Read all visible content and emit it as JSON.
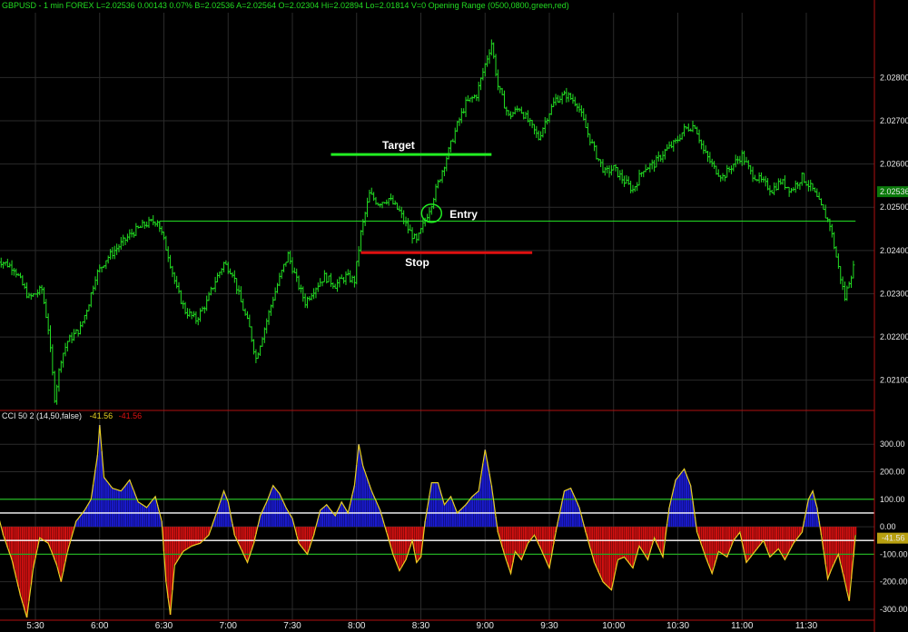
{
  "header": {
    "price_line": "GBPUSD - 1 min  FOREX  L=2.02536  0.00143   0.07%    B=2.02536   A=2.02564   O=2.02304   Hi=2.02894   Lo=2.01814   V=0   Opening Range (0500,0800,green,red)"
  },
  "indicator_header": {
    "name": "CCI 50 2 (14,50,false)",
    "value1": "-41.56",
    "value2": "-41.56"
  },
  "colors": {
    "background": "#000000",
    "bars": "#22dd22",
    "grid": "#2a2a2a",
    "panel_border": "#b01010",
    "target": "#22ee22",
    "stop": "#e01010",
    "cci_line": "#e8d020",
    "cci_positive": "#1a1ad0",
    "cci_negative": "#d01010",
    "level_green": "#22aa22",
    "level_white": "#ffffff"
  },
  "chart_data": [
    {
      "type": "ohlc",
      "instrument": "GBPUSD",
      "interval": "1 min",
      "x_ticks": [
        "5:30",
        "6:00",
        "6:30",
        "7:00",
        "7:30",
        "8:00",
        "8:30",
        "9:00",
        "9:30",
        "10:00",
        "10:30",
        "11:00",
        "11:30"
      ],
      "y_ticks": [
        "2.02800",
        "2.02700",
        "2.02600",
        "2.02500",
        "2.02400",
        "2.02300",
        "2.02200",
        "2.02100"
      ],
      "y_range": [
        2.0203,
        2.0295
      ],
      "last_price_label": "2.02536",
      "last_price": 2.02536,
      "high": 2.02894,
      "low": 2.01814,
      "path": [
        [
          "5:12",
          2.0238
        ],
        [
          "5:20",
          2.0236
        ],
        [
          "5:27",
          2.0229
        ],
        [
          "5:33",
          2.0231
        ],
        [
          "5:36",
          2.0222
        ],
        [
          "5:39",
          2.0206
        ],
        [
          "5:42",
          2.0215
        ],
        [
          "5:45",
          2.0219
        ],
        [
          "5:51",
          2.0222
        ],
        [
          "5:55",
          2.0228
        ],
        [
          "5:58",
          2.0234
        ],
        [
          "6:03",
          2.0238
        ],
        [
          "6:09",
          2.0241
        ],
        [
          "6:15",
          2.0244
        ],
        [
          "6:21",
          2.0246
        ],
        [
          "6:27",
          2.0247
        ],
        [
          "6:32",
          2.0239
        ],
        [
          "6:36",
          2.0231
        ],
        [
          "6:40",
          2.0226
        ],
        [
          "6:45",
          2.0224
        ],
        [
          "6:50",
          2.0228
        ],
        [
          "6:54",
          2.0233
        ],
        [
          "6:58",
          2.0237
        ],
        [
          "7:02",
          2.0235
        ],
        [
          "7:06",
          2.0228
        ],
        [
          "7:10",
          2.0222
        ],
        [
          "7:13",
          2.0215
        ],
        [
          "7:17",
          2.0222
        ],
        [
          "7:21",
          2.0229
        ],
        [
          "7:25",
          2.0235
        ],
        [
          "7:28",
          2.0239
        ],
        [
          "7:32",
          2.0233
        ],
        [
          "7:36",
          2.0228
        ],
        [
          "7:40",
          2.0231
        ],
        [
          "7:45",
          2.0234
        ],
        [
          "7:50",
          2.0232
        ],
        [
          "7:55",
          2.0234
        ],
        [
          "7:59",
          2.0233
        ],
        [
          "8:02",
          2.0244
        ],
        [
          "8:06",
          2.0253
        ],
        [
          "8:10",
          2.0251
        ],
        [
          "8:15",
          2.0252
        ],
        [
          "8:20",
          2.0249
        ],
        [
          "8:24",
          2.0245
        ],
        [
          "8:28",
          2.0242
        ],
        [
          "8:32",
          2.0247
        ],
        [
          "8:35",
          2.0251
        ],
        [
          "8:39",
          2.0257
        ],
        [
          "8:43",
          2.0263
        ],
        [
          "8:47",
          2.0269
        ],
        [
          "8:51",
          2.0274
        ],
        [
          "8:56",
          2.0276
        ],
        [
          "9:00",
          2.0283
        ],
        [
          "9:03",
          2.0288
        ],
        [
          "9:06",
          2.0278
        ],
        [
          "9:11",
          2.0271
        ],
        [
          "9:16",
          2.0273
        ],
        [
          "9:20",
          2.027
        ],
        [
          "9:25",
          2.0266
        ],
        [
          "9:29",
          2.0271
        ],
        [
          "9:33",
          2.0275
        ],
        [
          "9:38",
          2.0276
        ],
        [
          "9:43",
          2.0274
        ],
        [
          "9:48",
          2.0267
        ],
        [
          "9:52",
          2.0262
        ],
        [
          "9:56",
          2.0258
        ],
        [
          "10:00",
          2.0259
        ],
        [
          "10:05",
          2.0256
        ],
        [
          "10:09",
          2.0254
        ],
        [
          "10:14",
          2.0259
        ],
        [
          "10:19",
          2.026
        ],
        [
          "10:24",
          2.0263
        ],
        [
          "10:29",
          2.0265
        ],
        [
          "10:33",
          2.0268
        ],
        [
          "10:38",
          2.0269
        ],
        [
          "10:42",
          2.0263
        ],
        [
          "10:47",
          2.0259
        ],
        [
          "10:51",
          2.0257
        ],
        [
          "10:56",
          2.026
        ],
        [
          "11:00",
          2.0262
        ],
        [
          "11:04",
          2.0258
        ],
        [
          "11:09",
          2.0256
        ],
        [
          "11:14",
          2.0254
        ],
        [
          "11:18",
          2.0256
        ],
        [
          "11:23",
          2.0254
        ],
        [
          "11:28",
          2.0257
        ],
        [
          "11:33",
          2.0254
        ],
        [
          "11:37",
          2.025
        ],
        [
          "11:41",
          2.0246
        ],
        [
          "11:45",
          2.0236
        ],
        [
          "11:48",
          2.0229
        ],
        [
          "11:50",
          2.0233
        ],
        [
          "11:52",
          2.0236
        ]
      ],
      "opening_range_line": {
        "price": 2.02468,
        "from": "6:28",
        "to": "11:53"
      },
      "annotations": [
        {
          "label": "Target",
          "price": 2.02622,
          "from": "7:48",
          "to": "9:03"
        },
        {
          "label": "Stop",
          "price": 2.02395,
          "from": "8:02",
          "to": "9:22"
        },
        {
          "label": "Entry",
          "price": 2.02486,
          "time": "8:35"
        }
      ]
    },
    {
      "type": "area",
      "name": "CCI 50 2 (14,50,false)",
      "y_ticks": [
        "300.00",
        "200.00",
        "100.00",
        "0.00",
        "-100.00",
        "-200.00",
        "-300.00"
      ],
      "y_range": [
        -340,
        390
      ],
      "levels": [
        100,
        50,
        -50,
        -100
      ],
      "last_value_label": "-41.56",
      "last_value": -41.56,
      "path": [
        [
          "5:12",
          60
        ],
        [
          "5:15",
          -30
        ],
        [
          "5:19",
          -120
        ],
        [
          "5:23",
          -250
        ],
        [
          "5:26",
          -330
        ],
        [
          "5:29",
          -150
        ],
        [
          "5:32",
          -40
        ],
        [
          "5:36",
          -60
        ],
        [
          "5:40",
          -140
        ],
        [
          "5:42",
          -200
        ],
        [
          "5:45",
          -90
        ],
        [
          "5:49",
          20
        ],
        [
          "5:53",
          60
        ],
        [
          "5:56",
          100
        ],
        [
          "5:59",
          260
        ],
        [
          "6:00",
          370
        ],
        [
          "6:02",
          180
        ],
        [
          "6:06",
          140
        ],
        [
          "6:10",
          130
        ],
        [
          "6:14",
          170
        ],
        [
          "6:18",
          90
        ],
        [
          "6:22",
          70
        ],
        [
          "6:26",
          110
        ],
        [
          "6:29",
          20
        ],
        [
          "6:31",
          -200
        ],
        [
          "6:33",
          -320
        ],
        [
          "6:35",
          -140
        ],
        [
          "6:39",
          -90
        ],
        [
          "6:43",
          -70
        ],
        [
          "6:47",
          -60
        ],
        [
          "6:51",
          -30
        ],
        [
          "6:55",
          60
        ],
        [
          "6:58",
          130
        ],
        [
          "7:00",
          90
        ],
        [
          "7:03",
          -30
        ],
        [
          "7:06",
          -80
        ],
        [
          "7:09",
          -130
        ],
        [
          "7:12",
          -60
        ],
        [
          "7:15",
          40
        ],
        [
          "7:18",
          90
        ],
        [
          "7:21",
          150
        ],
        [
          "7:24",
          120
        ],
        [
          "7:27",
          70
        ],
        [
          "7:30",
          30
        ],
        [
          "7:33",
          -60
        ],
        [
          "7:37",
          -100
        ],
        [
          "7:40",
          -30
        ],
        [
          "7:43",
          60
        ],
        [
          "7:46",
          80
        ],
        [
          "7:50",
          40
        ],
        [
          "7:53",
          90
        ],
        [
          "7:56",
          50
        ],
        [
          "7:59",
          150
        ],
        [
          "8:01",
          300
        ],
        [
          "8:03",
          220
        ],
        [
          "8:07",
          130
        ],
        [
          "8:11",
          60
        ],
        [
          "8:14",
          -20
        ],
        [
          "8:17",
          -100
        ],
        [
          "8:20",
          -160
        ],
        [
          "8:23",
          -120
        ],
        [
          "8:26",
          -50
        ],
        [
          "8:28",
          -130
        ],
        [
          "8:30",
          -110
        ],
        [
          "8:32",
          20
        ],
        [
          "8:35",
          160
        ],
        [
          "8:38",
          160
        ],
        [
          "8:41",
          80
        ],
        [
          "8:44",
          110
        ],
        [
          "8:47",
          50
        ],
        [
          "8:51",
          80
        ],
        [
          "8:54",
          110
        ],
        [
          "8:57",
          130
        ],
        [
          "9:00",
          280
        ],
        [
          "9:03",
          150
        ],
        [
          "9:06",
          -20
        ],
        [
          "9:09",
          -100
        ],
        [
          "9:12",
          -170
        ],
        [
          "9:14",
          -90
        ],
        [
          "9:17",
          -120
        ],
        [
          "9:20",
          -60
        ],
        [
          "9:23",
          -30
        ],
        [
          "9:26",
          -80
        ],
        [
          "9:30",
          -150
        ],
        [
          "9:33",
          -20
        ],
        [
          "9:37",
          130
        ],
        [
          "9:40",
          140
        ],
        [
          "9:44",
          70
        ],
        [
          "9:47",
          -20
        ],
        [
          "9:51",
          -130
        ],
        [
          "9:55",
          -200
        ],
        [
          "9:59",
          -230
        ],
        [
          "10:02",
          -120
        ],
        [
          "10:05",
          -110
        ],
        [
          "10:09",
          -150
        ],
        [
          "10:12",
          -70
        ],
        [
          "10:16",
          -120
        ],
        [
          "10:19",
          -40
        ],
        [
          "10:23",
          -110
        ],
        [
          "10:26",
          70
        ],
        [
          "10:29",
          170
        ],
        [
          "10:33",
          210
        ],
        [
          "10:36",
          150
        ],
        [
          "10:39",
          -20
        ],
        [
          "10:43",
          -110
        ],
        [
          "10:46",
          -170
        ],
        [
          "10:49",
          -90
        ],
        [
          "10:53",
          -110
        ],
        [
          "10:56",
          -50
        ],
        [
          "10:59",
          -20
        ],
        [
          "11:02",
          -130
        ],
        [
          "11:06",
          -90
        ],
        [
          "11:10",
          -50
        ],
        [
          "11:13",
          -110
        ],
        [
          "11:17",
          -80
        ],
        [
          "11:20",
          -120
        ],
        [
          "11:24",
          -60
        ],
        [
          "11:28",
          -20
        ],
        [
          "11:31",
          100
        ],
        [
          "11:33",
          130
        ],
        [
          "11:35",
          70
        ],
        [
          "11:37",
          -30
        ],
        [
          "11:40",
          -190
        ],
        [
          "11:42",
          -150
        ],
        [
          "11:45",
          -100
        ],
        [
          "11:48",
          -200
        ],
        [
          "11:50",
          -270
        ],
        [
          "11:53",
          -30
        ]
      ]
    }
  ]
}
